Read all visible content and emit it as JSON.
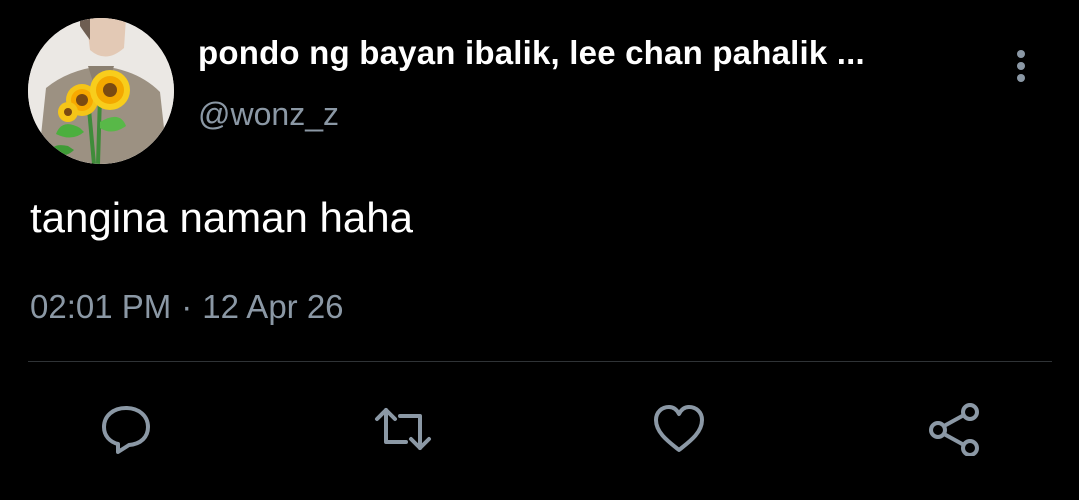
{
  "tweet": {
    "display_name": "pondo ng bayan ibalik, lee chan pahalik ...",
    "handle": "@wonz_z",
    "text": "tangina naman haha",
    "time": "02:01 PM",
    "separator": "·",
    "date": "12 Apr 26"
  },
  "colors": {
    "background": "#000000",
    "primary_text": "#ffffff",
    "secondary_text": "#8b98a5",
    "divider": "#2f3336",
    "icon": "#8b98a5"
  },
  "icons": {
    "more": "more-vertical-icon",
    "reply": "reply-icon",
    "retweet": "retweet-icon",
    "like": "heart-icon",
    "share": "share-icon"
  }
}
